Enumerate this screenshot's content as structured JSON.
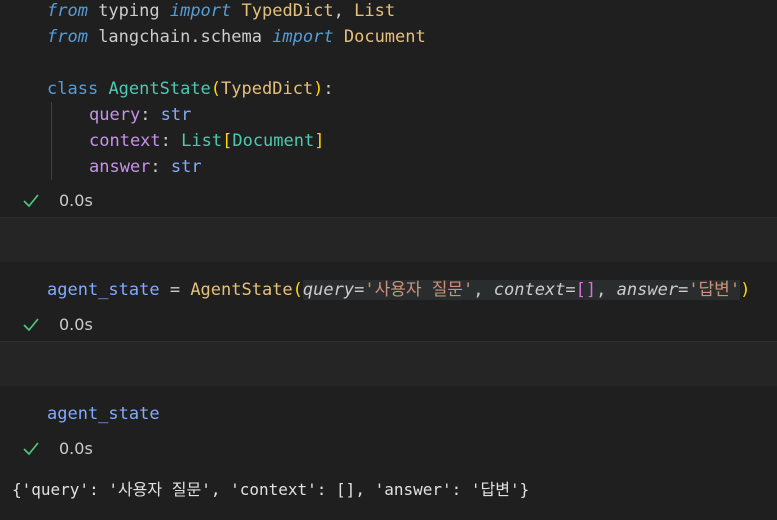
{
  "cell1": {
    "line1": {
      "kw1": "from",
      "mod": " typing ",
      "kw2": "import",
      "sp": " ",
      "name1": "TypedDict",
      "comma": ", ",
      "name2": "List"
    },
    "line2": {
      "kw1": "from",
      "mod": " langchain.schema ",
      "kw2": "import",
      "sp": " ",
      "name1": "Document"
    },
    "line4": {
      "kw": "class",
      "sp": " ",
      "name": "AgentState",
      "open": "(",
      "base": "TypedDict",
      "close": ")",
      "colon": ":"
    },
    "line5": {
      "field": "query",
      "colon": ": ",
      "type": "str"
    },
    "line6": {
      "field": "context",
      "colon": ": ",
      "type": "List",
      "open": "[",
      "inner": "Document",
      "close": "]"
    },
    "line7": {
      "field": "answer",
      "colon": ": ",
      "type": "str"
    },
    "status_time": "0.0s"
  },
  "cell2": {
    "var": "agent_state",
    "eq": " = ",
    "cls": "AgentState",
    "open": "(",
    "p1": "query",
    "v1": "'사용자 질문'",
    "p2": "context",
    "v2open": "[",
    "v2close": "]",
    "p3": "answer",
    "v3": "'답변'",
    "close": ")",
    "eqsign": "=",
    "sep": ", ",
    "status_time": "0.0s"
  },
  "cell3": {
    "var": "agent_state",
    "status_time": "0.0s",
    "output": "{'query': '사용자 질문', 'context': [], 'answer': '답변'}"
  },
  "colors": {
    "check": "#4ec97d",
    "background": "#1f1f1f"
  }
}
